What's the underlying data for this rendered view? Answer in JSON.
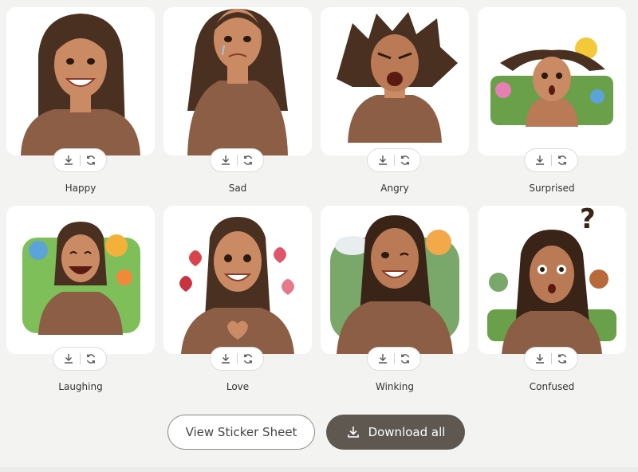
{
  "stickers": [
    {
      "label": "Happy",
      "mood": "happy"
    },
    {
      "label": "Sad",
      "mood": "sad"
    },
    {
      "label": "Angry",
      "mood": "angry"
    },
    {
      "label": "Surprised",
      "mood": "surprised"
    },
    {
      "label": "Laughing",
      "mood": "laughing"
    },
    {
      "label": "Love",
      "mood": "love"
    },
    {
      "label": "Winking",
      "mood": "winking"
    },
    {
      "label": "Confused",
      "mood": "confused"
    }
  ],
  "icons": {
    "download": "download-icon",
    "regenerate": "refresh-icon"
  },
  "actions": {
    "view_sheet_label": "View Sticker Sheet",
    "download_all_label": "Download all"
  },
  "colors": {
    "accent_dark": "#5e5851",
    "skin": "#c98a64",
    "hair": "#4a3020",
    "sweater": "#8b5e45"
  }
}
